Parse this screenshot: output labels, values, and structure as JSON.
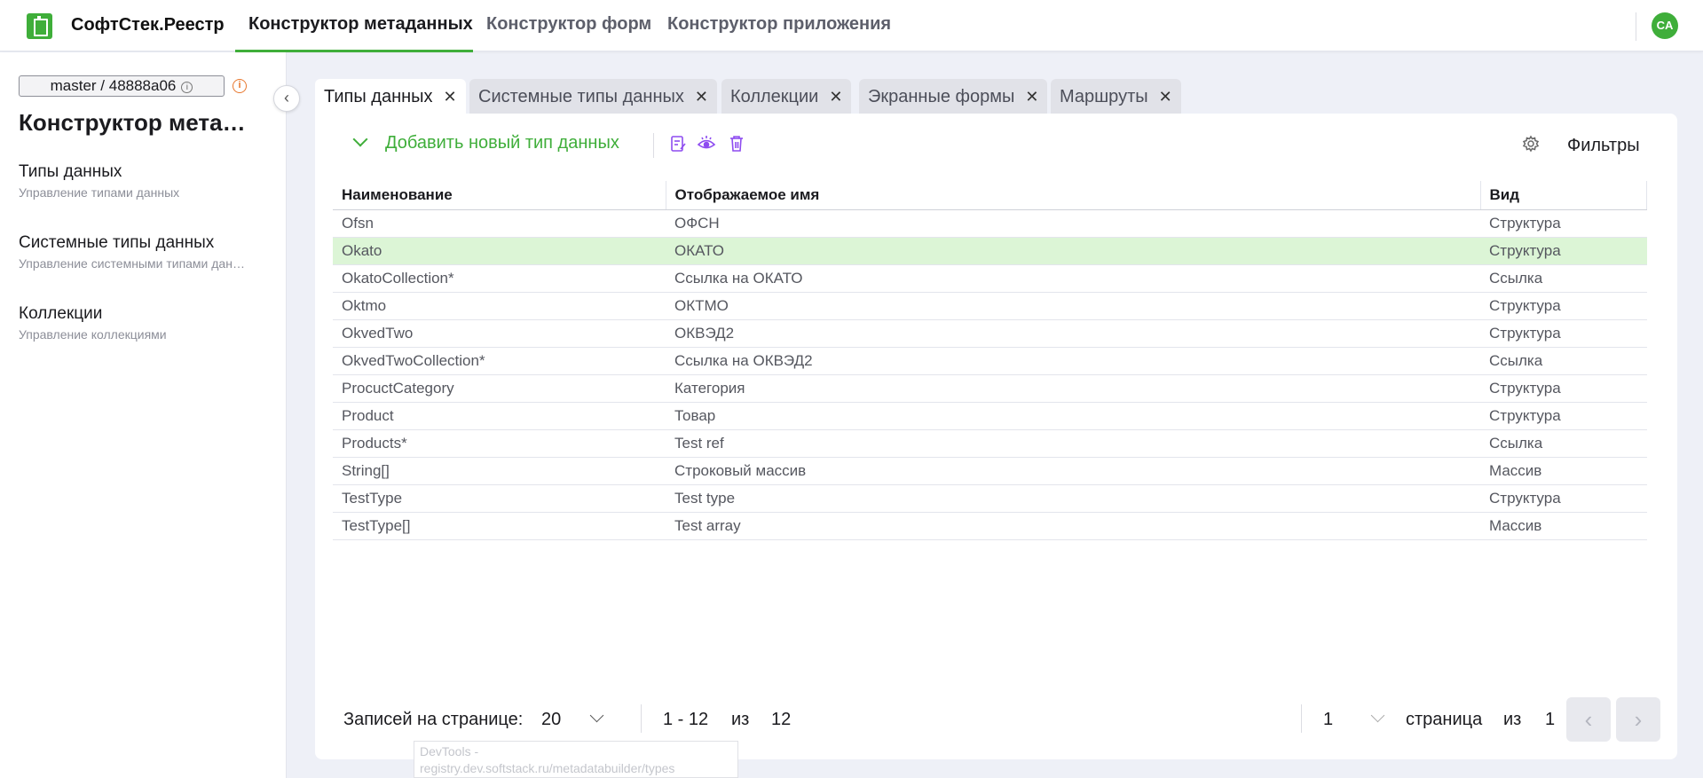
{
  "header": {
    "brand": "СофтСтек.Реестр",
    "nav": [
      "Конструктор метаданных",
      "Конструктор форм",
      "Конструктор приложения"
    ],
    "user_initials": "CA",
    "accent": "#3fae3a"
  },
  "sidebar": {
    "branch": "master / 48888a06",
    "title": "Конструктор метаданных",
    "items": [
      {
        "title": "Типы данных",
        "subtitle": "Управление типами данных"
      },
      {
        "title": "Системные типы данных",
        "subtitle": "Управление системными типами данных"
      },
      {
        "title": "Коллекции",
        "subtitle": "Управление коллекциями"
      }
    ]
  },
  "tabs": [
    "Типы данных",
    "Системные типы данных",
    "Коллекции",
    "Экранные формы",
    "Маршруты"
  ],
  "toolbar": {
    "add_label": "Добавить новый тип данных",
    "filters_label": "Фильтры",
    "icons": [
      "edit-icon",
      "view-icon",
      "delete-icon",
      "settings-icon"
    ]
  },
  "table": {
    "columns": [
      "Наименование",
      "Отображаемое имя",
      "Вид"
    ],
    "rows": [
      [
        "Ofsn",
        "ОФСН",
        "Структура"
      ],
      [
        "Okato",
        "ОКАТО",
        "Структура"
      ],
      [
        "OkatoCollection*",
        "Ссылка на ОКАТО",
        "Ссылка"
      ],
      [
        "Oktmo",
        "ОКТМО",
        "Структура"
      ],
      [
        "OkvedTwo",
        "ОКВЭД2",
        "Структура"
      ],
      [
        "OkvedTwoCollection*",
        "Ссылка на ОКВЭД2",
        "Ссылка"
      ],
      [
        "ProcuctCategory",
        "Категория",
        "Структура"
      ],
      [
        "Product",
        "Товар",
        "Структура"
      ],
      [
        "Products*",
        "Test ref",
        "Ссылка"
      ],
      [
        "String[]",
        "Строковый массив",
        "Массив"
      ],
      [
        "TestType",
        "Test type",
        "Структура"
      ],
      [
        "TestType[]",
        "Test array",
        "Массив"
      ]
    ],
    "selected_row": 1
  },
  "pagination": {
    "per_page_label": "Записей на странице:",
    "per_page": "20",
    "range": "1 - 12",
    "of_label": "из",
    "total": "12",
    "page": "1",
    "page_label": "страница",
    "of_label2": "из",
    "pages": "1"
  },
  "tooltip": {
    "text": "DevTools - registry.dev.softstack.ru/metadatabuilder/types"
  }
}
